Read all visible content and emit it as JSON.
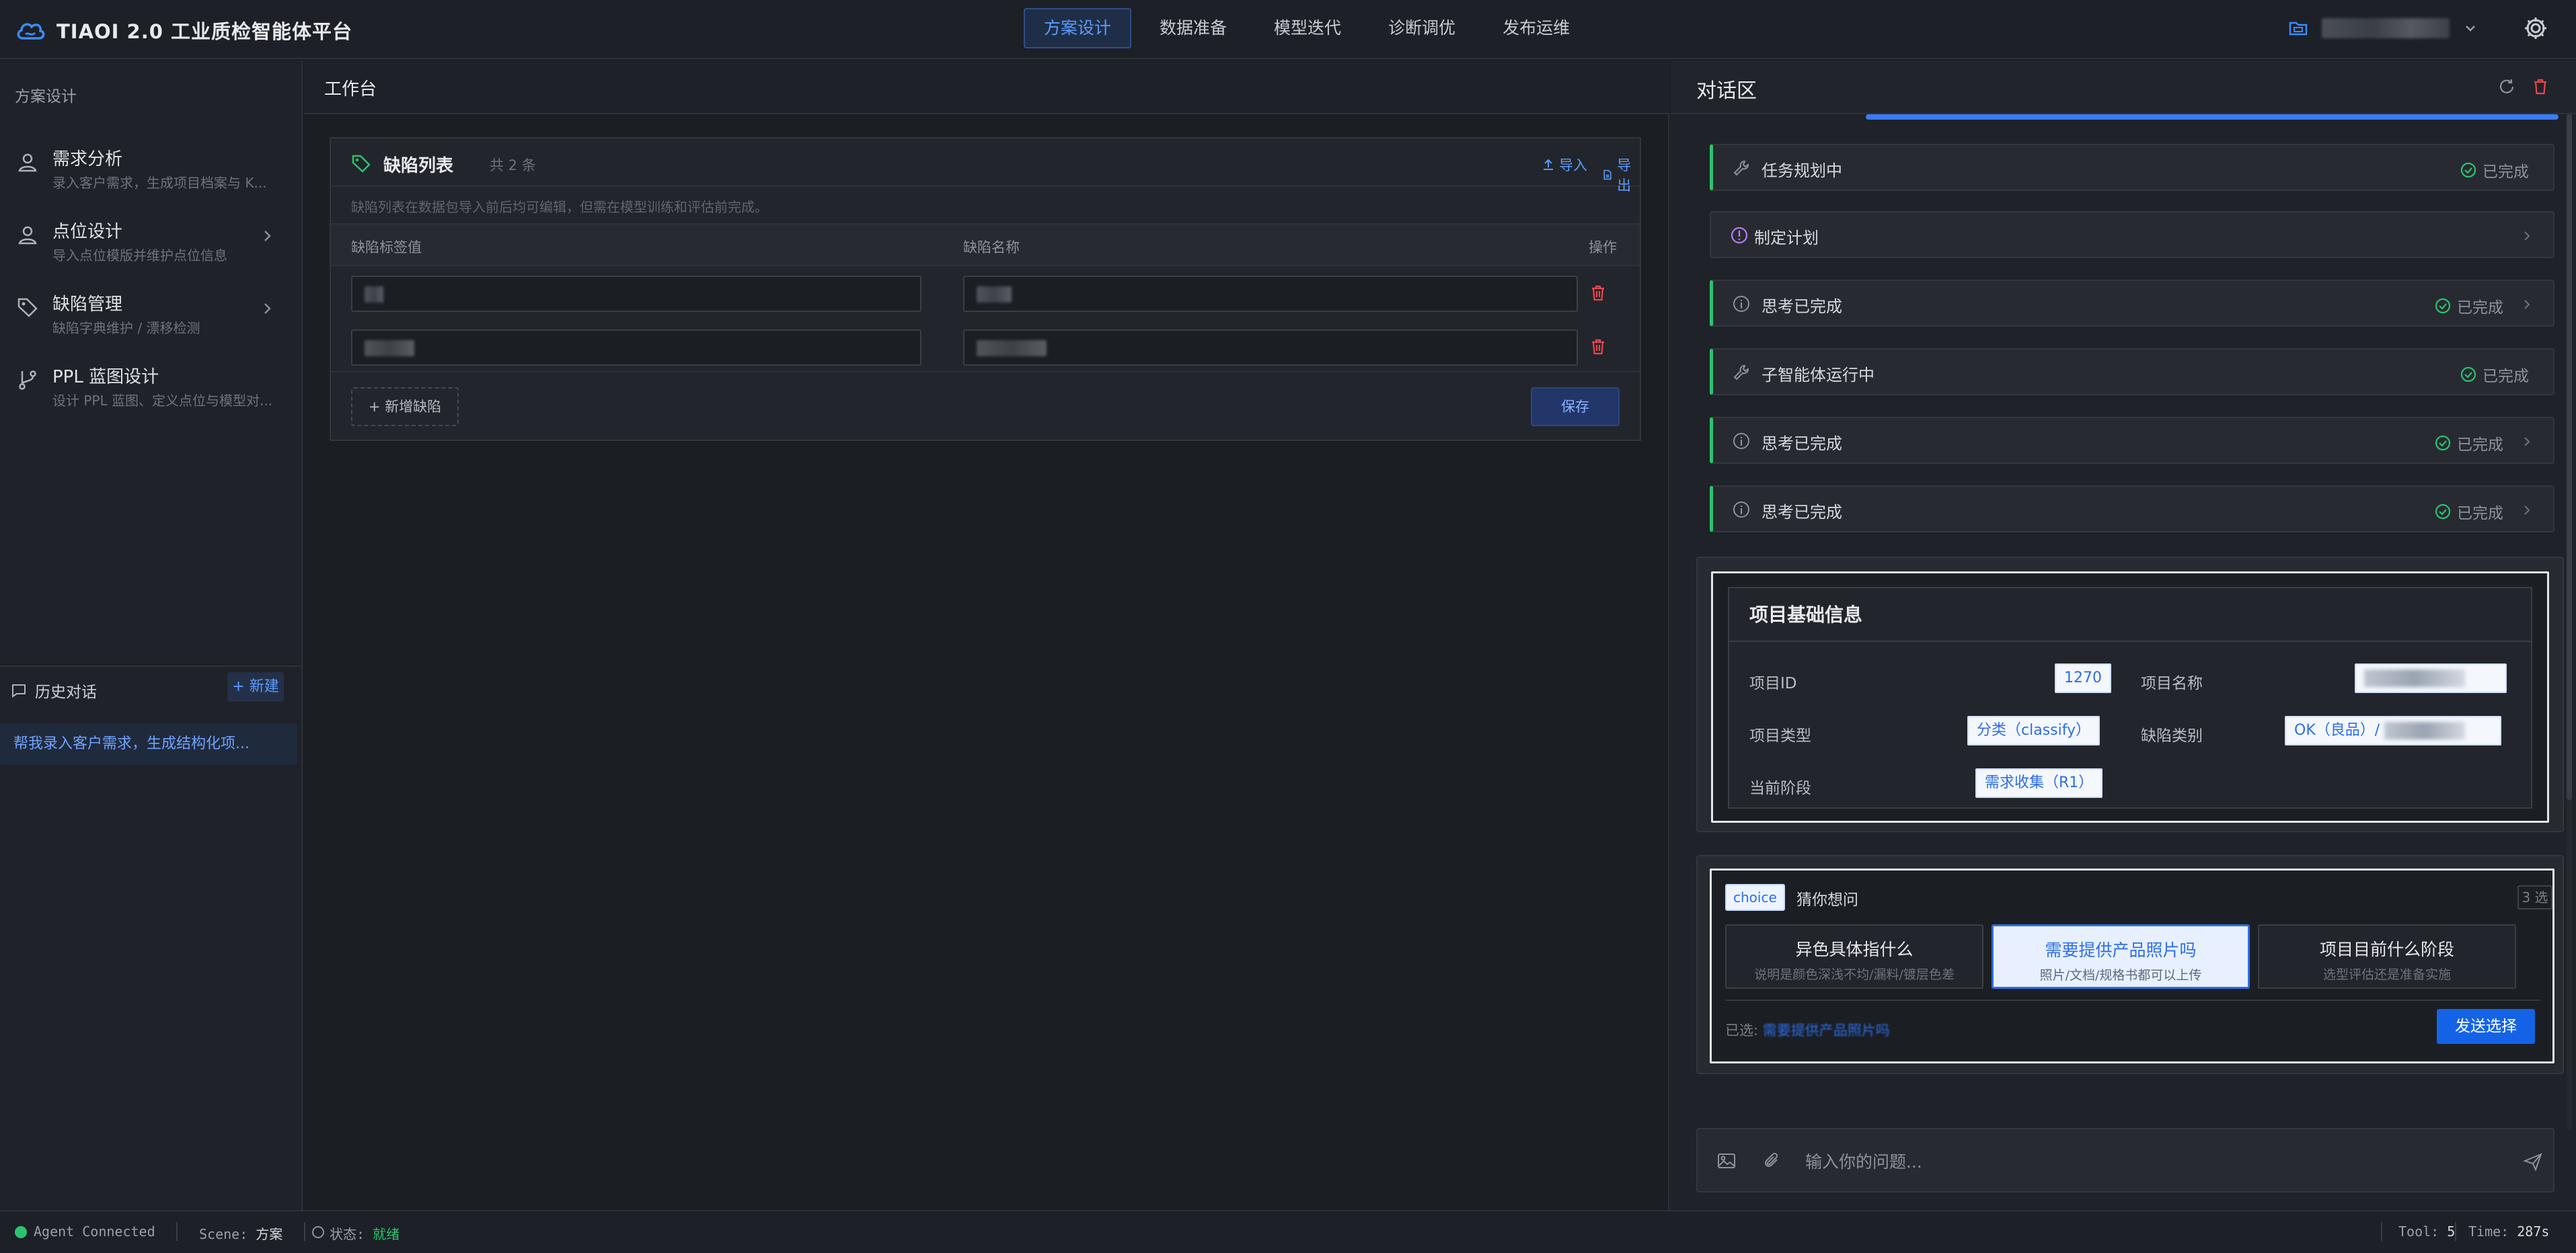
{
  "app": {
    "title": "TIAOI 2.0 工业质检智能体平台"
  },
  "nav": {
    "tabs": [
      {
        "label": "方案设计",
        "active": true
      },
      {
        "label": "数据准备"
      },
      {
        "label": "模型迭代"
      },
      {
        "label": "诊断调优"
      },
      {
        "label": "发布运维"
      }
    ]
  },
  "sidebar": {
    "title": "方案设计",
    "items": [
      {
        "label": "需求分析",
        "sub": "录入客户需求，生成项目档案与 K..."
      },
      {
        "label": "点位设计",
        "sub": "导入点位模版并维护点位信息"
      },
      {
        "label": "缺陷管理",
        "sub": "缺陷字典维护 / 漂移检测"
      },
      {
        "label": "PPL 蓝图设计",
        "sub": "设计 PPL 蓝图、定义点位与模型对..."
      }
    ],
    "history": {
      "title": "历史对话",
      "new_label": "+ 新建",
      "items": [
        "帮我录入客户需求，生成结构化项..."
      ]
    }
  },
  "workspace": {
    "title": "工作台",
    "defect_card": {
      "title": "缺陷列表",
      "count": "共 2 条",
      "import_label": "导入",
      "export_label": "导出",
      "note": "缺陷列表在数据包导入前后均可编辑，但需在模型训练和评估前完成。",
      "columns": [
        "缺陷标签值",
        "缺陷名称",
        "操作"
      ],
      "add_label": "+ 新增缺陷",
      "save_label": "保存"
    }
  },
  "chat": {
    "title": "对话区",
    "steps": [
      {
        "label": "任务规划中",
        "status": "已完成"
      },
      {
        "label": "制定计划",
        "status": ""
      },
      {
        "label": "思考已完成",
        "status": "已完成"
      },
      {
        "label": "子智能体运行中",
        "status": "已完成"
      },
      {
        "label": "思考已完成",
        "status": "已完成"
      },
      {
        "label": "思考已完成",
        "status": "已完成"
      }
    ],
    "project_info": {
      "title": "项目基础信息",
      "fields": {
        "id_label": "项目ID",
        "id_value": "1270",
        "name_label": "项目名称",
        "type_label": "项目类型",
        "type_value": "分类（classify）",
        "defect_label": "缺陷类别",
        "defect_value": "OK（良品）/",
        "stage_label": "当前阶段",
        "stage_value": "需求收集（R1）"
      }
    },
    "choice": {
      "badge": "choice",
      "question": "猜你想问",
      "count": "3 选",
      "options": [
        {
          "title": "异色具体指什么",
          "sub": "说明是颜色深浅不均/漏料/镀层色差",
          "selected": false
        },
        {
          "title": "需要提供产品照片吗",
          "sub": "照片/文档/规格书都可以上传",
          "selected": true
        },
        {
          "title": "项目目前什么阶段",
          "sub": "选型评估还是准备实施",
          "selected": false
        }
      ],
      "chosen_label": "已选:",
      "chosen_value": "需要提供产品照片吗",
      "send_label": "发送选择"
    },
    "input_placeholder": "输入你的问题..."
  },
  "statusbar": {
    "agent": "Agent Connected",
    "scene_label": "Scene:",
    "scene_value": "方案",
    "state_label": "状态:",
    "state_value": "就绪",
    "tool_label": "Tool:",
    "tool_value": "5",
    "time_label": "Time:",
    "time_value": "287s"
  },
  "colors": {
    "accent": "#3a7bf5",
    "success": "#2bc36f",
    "danger": "#e5484d"
  }
}
